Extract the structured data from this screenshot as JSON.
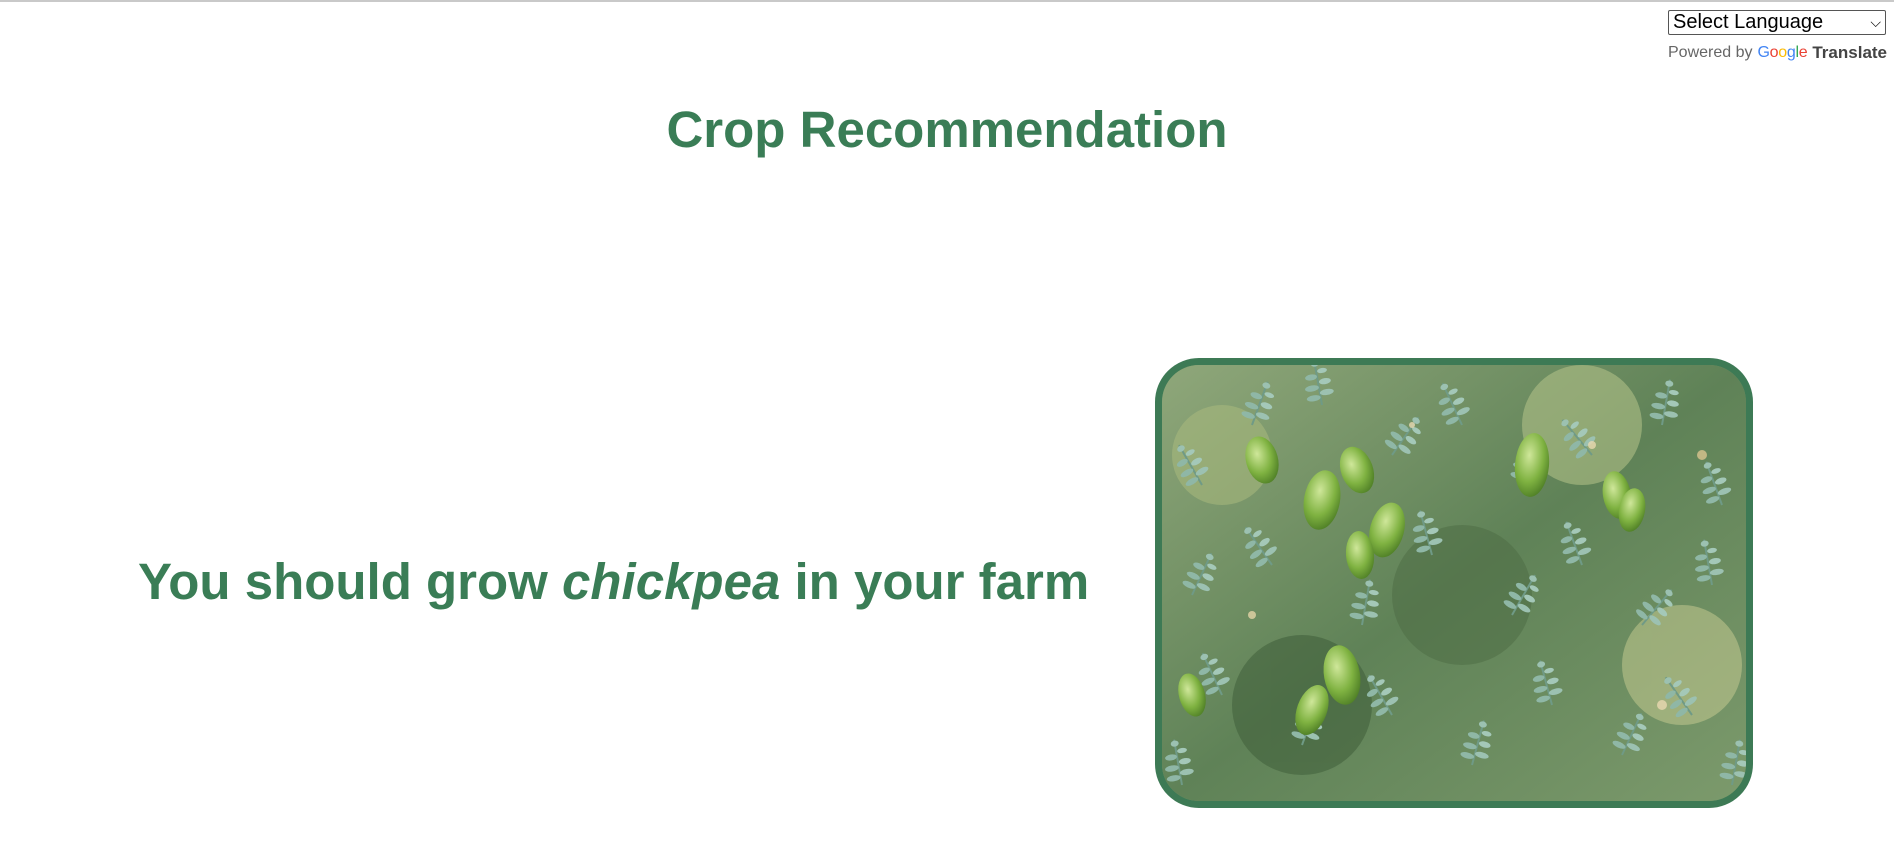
{
  "translate": {
    "select_label": "Select Language",
    "powered_by": "Powered by",
    "google_letters": [
      "G",
      "o",
      "o",
      "g",
      "l",
      "e"
    ],
    "translate_label": "Translate"
  },
  "header": {
    "title": "Crop Recommendation"
  },
  "result": {
    "prefix": "You should grow",
    "crop": "chickpea",
    "suffix": "in your farm"
  },
  "image": {
    "subject": "chickpea plants with green pods"
  },
  "colors": {
    "accent": "#3a7d56",
    "frame": "#3d7a55"
  }
}
